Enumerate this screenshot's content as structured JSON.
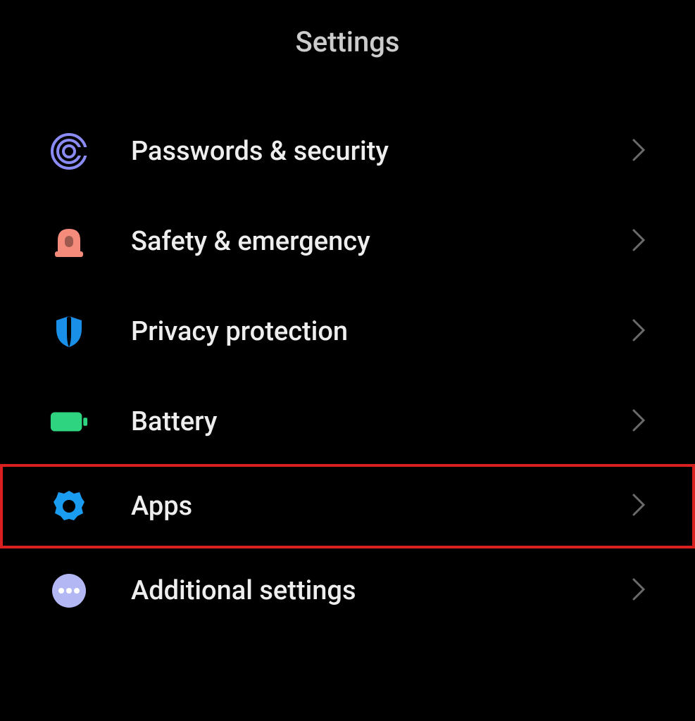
{
  "title": "Settings",
  "items": [
    {
      "label": "Passwords & security",
      "icon": "fingerprint-icon",
      "color": "#8b8bf5",
      "highlighted": false
    },
    {
      "label": "Safety & emergency",
      "icon": "siren-icon",
      "color": "#f58b7a",
      "highlighted": false
    },
    {
      "label": "Privacy protection",
      "icon": "shield-icon",
      "color": "#1a8fe8",
      "highlighted": false
    },
    {
      "label": "Battery",
      "icon": "battery-icon",
      "color": "#2ed47f",
      "highlighted": false
    },
    {
      "label": "Apps",
      "icon": "gear-icon",
      "color": "#1a9cf0",
      "highlighted": true
    },
    {
      "label": "Additional settings",
      "icon": "dots-icon",
      "color": "#b3b8f5",
      "highlighted": false
    }
  ]
}
